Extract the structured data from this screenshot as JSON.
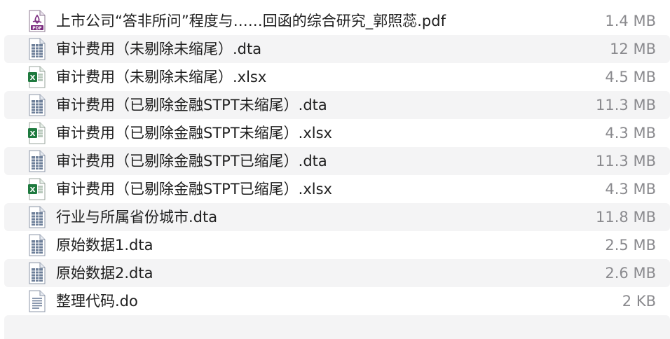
{
  "files": [
    {
      "name": "上市公司“答非所问”程度与……回函的综合研究_郭照蕊.pdf",
      "size": "1.4 MB",
      "icon": "pdf-file-icon"
    },
    {
      "name": "审计费用（未剔除未缩尾）.dta",
      "size": "12 MB",
      "icon": "dta-file-icon"
    },
    {
      "name": "审计费用（未剔除未缩尾）.xlsx",
      "size": "4.5 MB",
      "icon": "excel-file-icon"
    },
    {
      "name": "审计费用（已剔除金融STPT未缩尾）.dta",
      "size": "11.3 MB",
      "icon": "dta-file-icon"
    },
    {
      "name": "审计费用（已剔除金融STPT未缩尾）.xlsx",
      "size": "4.3 MB",
      "icon": "excel-file-icon"
    },
    {
      "name": "审计费用（已剔除金融STPT已缩尾）.dta",
      "size": "11.3 MB",
      "icon": "dta-file-icon"
    },
    {
      "name": "审计费用（已剔除金融STPT已缩尾）.xlsx",
      "size": "4.3 MB",
      "icon": "excel-file-icon"
    },
    {
      "name": "行业与所属省份城市.dta",
      "size": "11.8 MB",
      "icon": "dta-file-icon"
    },
    {
      "name": "原始数据1.dta",
      "size": "2.5 MB",
      "icon": "dta-file-icon"
    },
    {
      "name": "原始数据2.dta",
      "size": "2.6 MB",
      "icon": "dta-file-icon"
    },
    {
      "name": "整理代码.do",
      "size": "2 KB",
      "icon": "do-file-icon"
    }
  ],
  "colors": {
    "stripe": "#f4f4f5",
    "text": "#1f1f1f",
    "size_text": "#8a8a8e",
    "pdf_accent": "#7b2b7f",
    "dta_accent": "#6d7f99",
    "excel_green": "#1f7a3f"
  }
}
